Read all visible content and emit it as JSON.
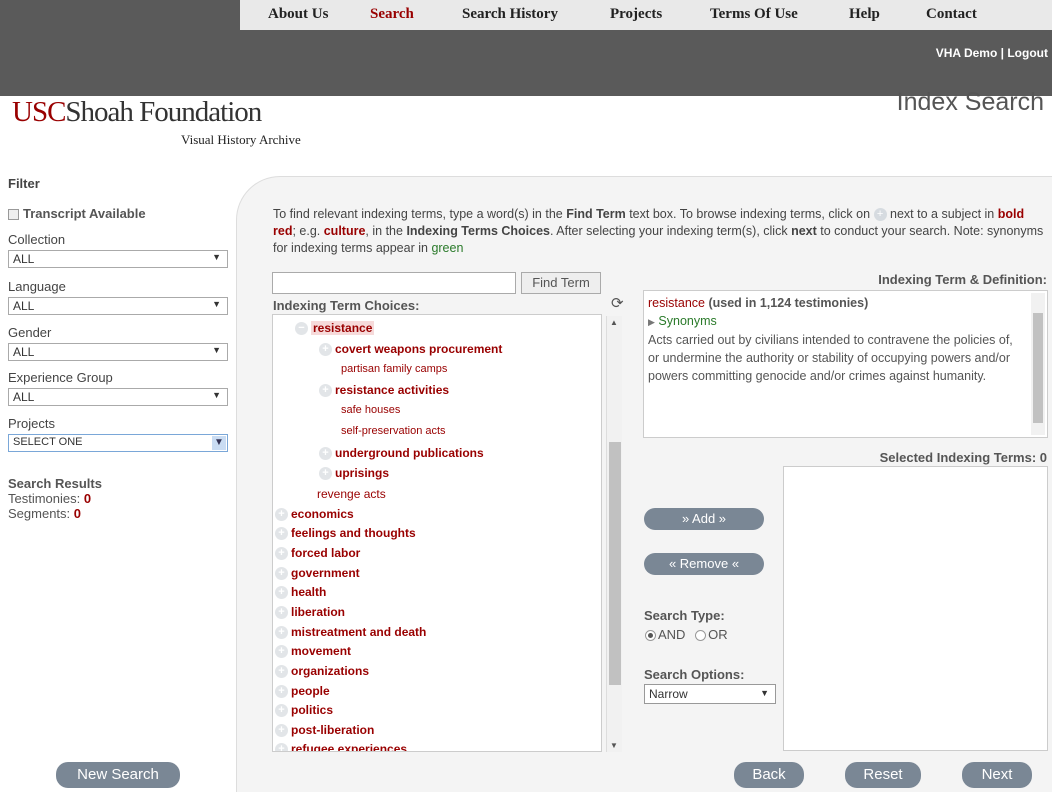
{
  "nav": {
    "items": [
      "About Us",
      "Search",
      "Search History",
      "Projects",
      "Terms Of Use",
      "Help",
      "Contact"
    ],
    "active": "Search",
    "user": "VHA Demo",
    "logout": "Logout",
    "separator": "|"
  },
  "logo": {
    "usc": "USC",
    "foundation": "Shoah Foundation",
    "sub": "Visual History Archive"
  },
  "page_title": "Index Search",
  "filter": {
    "title": "Filter",
    "transcript": "Transcript Available",
    "collection": {
      "label": "Collection",
      "value": "ALL"
    },
    "language": {
      "label": "Language",
      "value": "ALL"
    },
    "gender": {
      "label": "Gender",
      "value": "ALL"
    },
    "experience": {
      "label": "Experience Group",
      "value": "ALL"
    },
    "projects": {
      "label": "Projects",
      "value": "SELECT ONE"
    }
  },
  "results": {
    "title": "Search Results",
    "testimonies_label": "Testimonies:",
    "testimonies": "0",
    "segments_label": "Segments:",
    "segments": "0"
  },
  "new_search": "New Search",
  "intro": {
    "p1": "To find relevant indexing terms, type a word(s) in the",
    "find_term": "Find Term",
    "p2": "text box. To browse indexing terms, click on",
    "p3": "next to a subject in",
    "bold_red": "bold red",
    "p4": "; e.g.",
    "culture": "culture",
    "p5": ", in the",
    "itc": "Indexing Terms Choices",
    "p6": ". After selecting your indexing term(s), click",
    "next": "next",
    "p7": "to conduct your search. Note: synonyms for indexing terms appear in",
    "green": "green"
  },
  "find": {
    "button": "Find Term",
    "value": ""
  },
  "choices_label": "Indexing Term Choices:",
  "tree": [
    "resistance",
    "covert weapons procurement",
    "partisan family camps",
    "resistance activities",
    "safe houses",
    "self-preservation acts",
    "underground publications",
    "uprisings",
    "revenge acts",
    "economics",
    "feelings and thoughts",
    "forced labor",
    "government",
    "health",
    "liberation",
    "mistreatment and death",
    "movement",
    "organizations",
    "people",
    "politics",
    "post-liberation",
    "refugee experiences"
  ],
  "definition": {
    "label": "Indexing Term & Definition:",
    "term": "resistance",
    "used": "(used in 1,124 testimonies)",
    "synonyms": "Synonyms",
    "text": "Acts carried out by civilians intended to contravene the policies of, or undermine the authority or stability of occupying powers and/or powers committing genocide and/or crimes against humanity."
  },
  "selected_label": "Selected Indexing Terms: 0",
  "buttons": {
    "add": "» Add »",
    "remove": "« Remove «",
    "back": "Back",
    "reset": "Reset",
    "next": "Next"
  },
  "search_type": {
    "label": "Search Type:",
    "and": "AND",
    "or": "OR",
    "selected": "AND"
  },
  "search_options": {
    "label": "Search Options:",
    "value": "Narrow"
  }
}
